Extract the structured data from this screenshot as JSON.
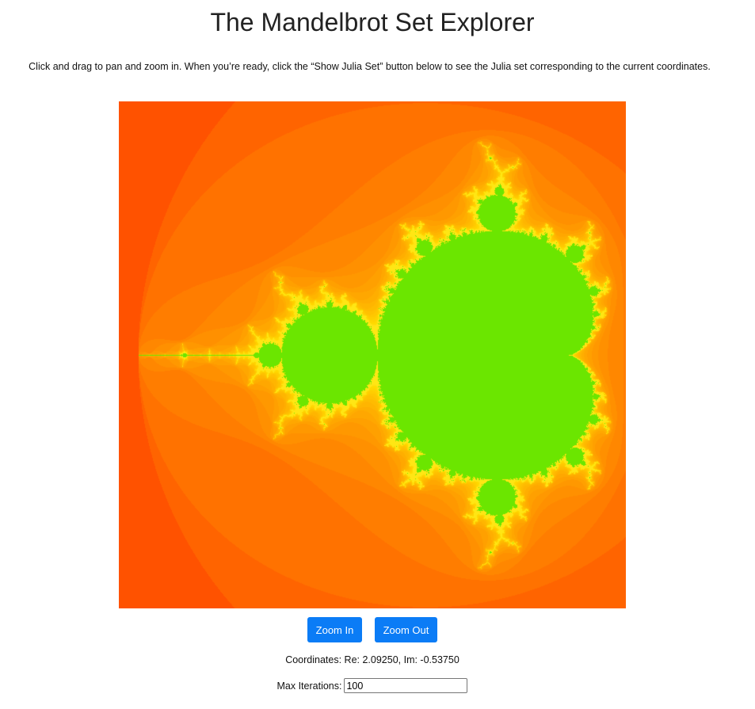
{
  "page": {
    "title": "The Mandelbrot Set Explorer",
    "intro": "Click and drag to pan and zoom in. When you’re ready, click the “Show Julia Set” button below to see the Julia set corresponding to the current coordinates."
  },
  "controls": {
    "zoom_in_label": "Zoom In",
    "zoom_out_label": "Zoom Out",
    "coordinates_text": "Coordinates: Re: 2.09250, Im: -0.53750",
    "max_iterations_label": "Max Iterations:",
    "max_iterations_value": "100"
  },
  "colors": {
    "button": "#0b7cf6",
    "set_interior": "#6be600",
    "outer_edge": "#ff3c00",
    "mid_orange": "#ff8400",
    "near_boundary": "#ffd200"
  }
}
